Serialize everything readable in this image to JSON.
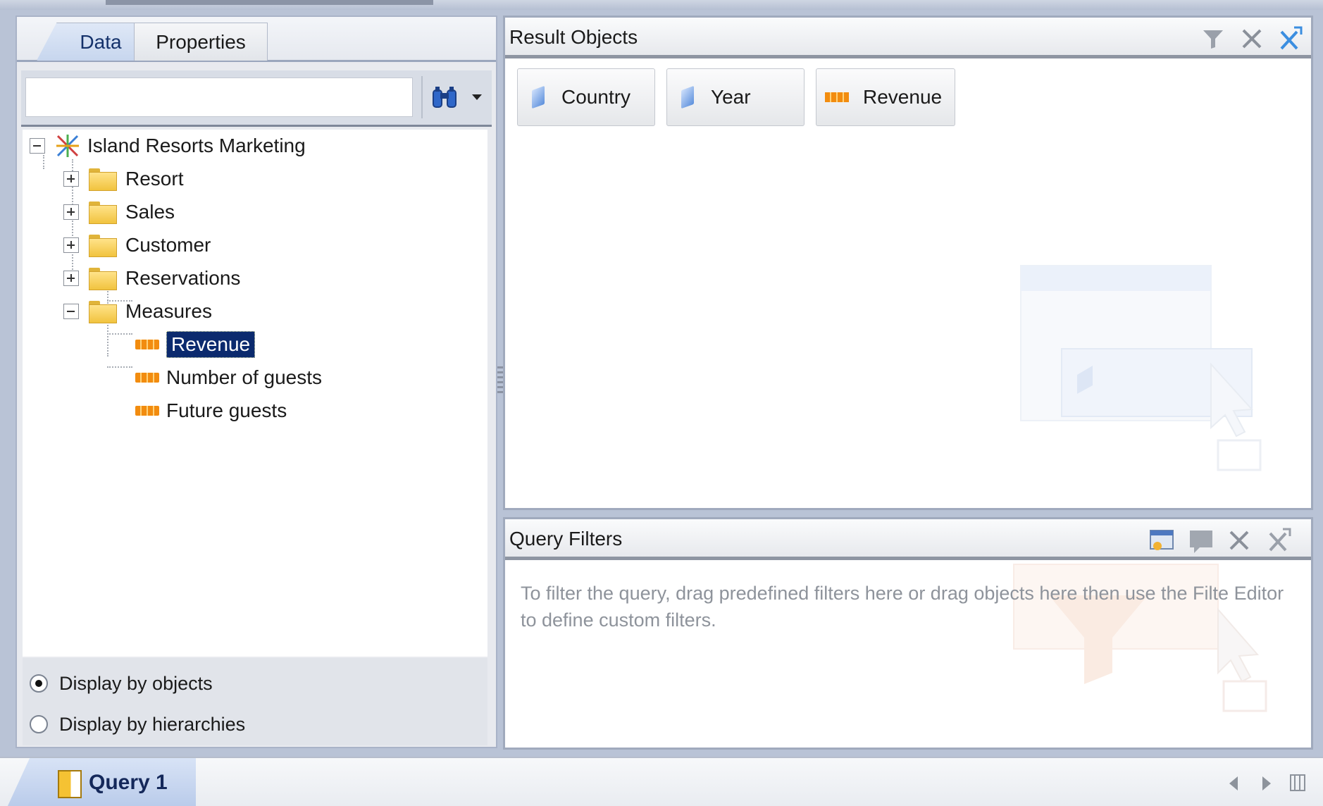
{
  "left_panel": {
    "tabs": [
      {
        "label": "Data"
      },
      {
        "label": "Properties"
      }
    ],
    "search": {
      "value": ""
    },
    "tree": {
      "root": "Island Resorts Marketing",
      "folders": [
        "Resort",
        "Sales",
        "Customer",
        "Reservations"
      ],
      "measures_folder": "Measures",
      "measures": [
        "Revenue",
        "Number of guests",
        "Future guests"
      ]
    },
    "display_options": [
      {
        "label": "Display by objects"
      },
      {
        "label": "Display by hierarchies"
      }
    ]
  },
  "result_objects": {
    "title": "Result Objects",
    "chips": [
      {
        "label": "Country",
        "kind": "dimension"
      },
      {
        "label": "Year",
        "kind": "dimension"
      },
      {
        "label": "Revenue",
        "kind": "measure"
      }
    ]
  },
  "query_filters": {
    "title": "Query Filters",
    "hint": "To filter the query, drag predefined filters here or drag objects here then use the Filte Editor to define custom filters."
  },
  "bottom": {
    "query_tab": "Query 1"
  },
  "colors": {
    "selection": "#0b2a6e",
    "measure": "#f28c0f",
    "dimension": "#5b8fdc",
    "folder": "#f1c33e"
  }
}
